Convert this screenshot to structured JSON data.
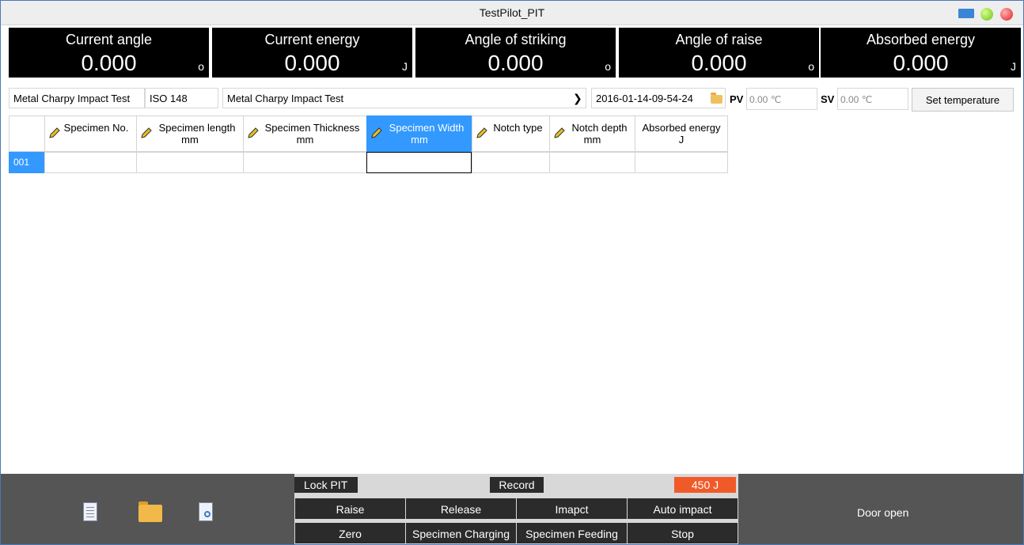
{
  "window": {
    "title": "TestPilot_PIT"
  },
  "readouts": [
    {
      "label": "Current angle",
      "value": "0.000",
      "unit": "o"
    },
    {
      "label": "Current energy",
      "value": "0.000",
      "unit": "J"
    },
    {
      "label": "Angle of striking",
      "value": "0.000",
      "unit": "o"
    },
    {
      "label": "Angle of raise",
      "value": "0.000",
      "unit": "o"
    },
    {
      "label": "Absorbed energy",
      "value": "0.000",
      "unit": "J"
    }
  ],
  "settings": {
    "test_type": "Metal Charpy Impact Test",
    "standard": "ISO 148",
    "method": "Metal Charpy Impact Test",
    "file_name": "2016-01-14-09-54-24",
    "pv_label": "PV",
    "pv_value": "0.00 ℃",
    "sv_label": "SV",
    "sv_value": "0.00 ℃",
    "set_temperature_label": "Set temperature"
  },
  "table": {
    "columns": [
      {
        "line1": "Specimen No.",
        "line2": "",
        "editable": true
      },
      {
        "line1": "Specimen length",
        "line2": "mm",
        "editable": true
      },
      {
        "line1": "Specimen Thickness",
        "line2": "mm",
        "editable": true
      },
      {
        "line1": "Specimen Width",
        "line2": "mm",
        "editable": true,
        "selected": true
      },
      {
        "line1": "Notch type",
        "line2": "",
        "editable": true
      },
      {
        "line1": "Notch depth",
        "line2": "mm",
        "editable": true
      },
      {
        "line1": "Absorbed energy",
        "line2": "J",
        "editable": false
      }
    ],
    "rows": [
      {
        "index": "001",
        "cells": [
          "",
          "",
          "",
          "",
          "",
          "",
          ""
        ]
      }
    ]
  },
  "controls": {
    "lock_label": "Lock PIT",
    "record_label": "Record",
    "energy_badge": "450 J",
    "buttons_row1": [
      "Raise",
      "Release",
      "Imapct",
      "Auto impact"
    ],
    "buttons_row2": [
      "Zero",
      "Specimen Charging",
      "Specimen Feeding",
      "Stop"
    ],
    "door_status": "Door open"
  },
  "icons": {
    "toolbar": [
      "new-document-icon",
      "open-folder-icon",
      "print-preview-icon"
    ],
    "column_edit": "pencil-icon",
    "file_browse": "folder-icon"
  },
  "colors": {
    "selection": "#3399ff",
    "energy_badge": "#f05a28",
    "readout_bg": "#000000",
    "bottom_bar": "#555555"
  }
}
